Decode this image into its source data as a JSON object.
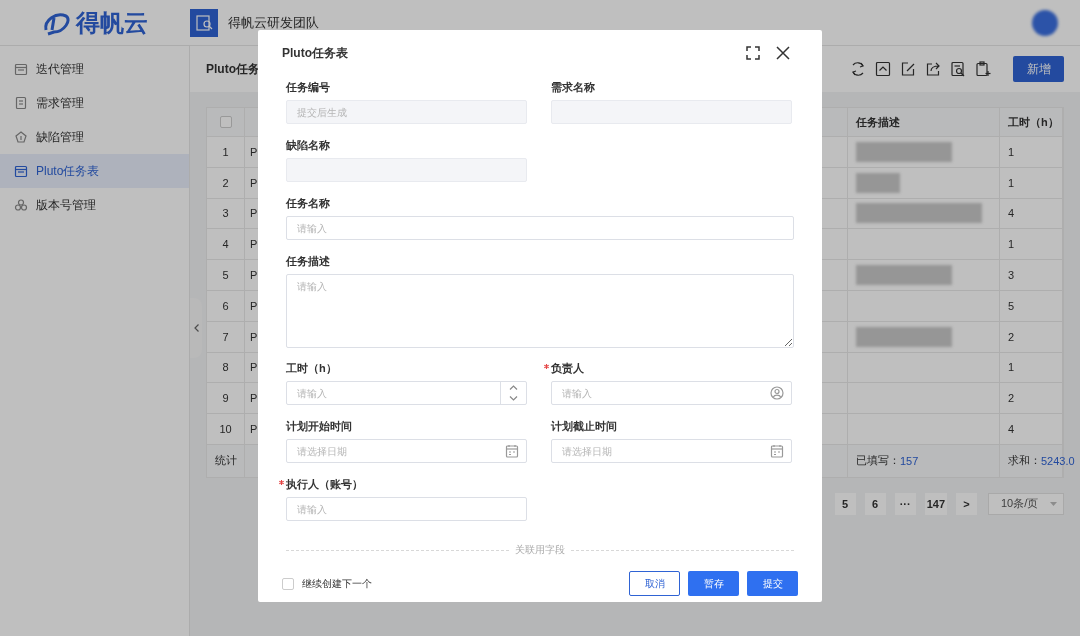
{
  "top_bar": {
    "logo_text": "得帆云",
    "team_name": "得帆云研发团队"
  },
  "sidebar": {
    "items": [
      {
        "label": "迭代管理",
        "selected": false
      },
      {
        "label": "需求管理",
        "selected": false
      },
      {
        "label": "缺陷管理",
        "selected": false
      },
      {
        "label": "Pluto任务表",
        "selected": true
      },
      {
        "label": "版本号管理",
        "selected": false
      }
    ]
  },
  "page": {
    "title": "Pluto任务",
    "new_button": "新增"
  },
  "table": {
    "select_all_checked": false,
    "columns": [
      "",
      "",
      "",
      "任务描述",
      "工时（h）"
    ],
    "rows": [
      {
        "index": "1",
        "task": "P",
        "description_blurred": true,
        "hours": "1"
      },
      {
        "index": "2",
        "task": "P",
        "description_blurred": true,
        "hours": "1"
      },
      {
        "index": "3",
        "task": "P",
        "description_blurred": true,
        "hours": "4"
      },
      {
        "index": "4",
        "task": "P",
        "description_blurred": false,
        "hours": "1"
      },
      {
        "index": "5",
        "task": "P",
        "description_blurred": true,
        "hours": "3"
      },
      {
        "index": "6",
        "task": "P",
        "description_blurred": false,
        "hours": "5"
      },
      {
        "index": "7",
        "task": "P",
        "description_blurred": true,
        "hours": "2"
      },
      {
        "index": "8",
        "task": "P",
        "description_blurred": false,
        "hours": "1"
      },
      {
        "index": "9",
        "task": "P",
        "description_blurred": false,
        "hours": "2"
      },
      {
        "index": "10",
        "task": "P",
        "description_blurred": false,
        "hours": "4"
      }
    ],
    "summary": {
      "label": "统计",
      "filled_label": "已填写：",
      "filled_value": "157",
      "sum_label": "求和：",
      "sum_value": "5243.0"
    }
  },
  "pagination": {
    "pages": [
      "5",
      "6",
      "···",
      "147"
    ],
    "next": ">",
    "page_size": "10条/页"
  },
  "modal": {
    "title": "Pluto任务表",
    "fields": [
      {
        "label": "任务编号",
        "kind": "text",
        "disabled": true,
        "required": false,
        "placeholder": "提交后生成"
      },
      {
        "label": "需求名称",
        "kind": "text",
        "disabled": true,
        "required": false
      },
      {
        "label": "缺陷名称",
        "kind": "text",
        "disabled": true,
        "required": false
      },
      {
        "label": "任务名称",
        "kind": "text",
        "disabled": false,
        "required": false,
        "placeholder": "请输入"
      },
      {
        "label": "任务描述",
        "kind": "textarea",
        "disabled": false,
        "required": false,
        "placeholder": "请输入"
      },
      {
        "label": "工时（h）",
        "kind": "number",
        "disabled": false,
        "required": false,
        "placeholder": "请输入"
      },
      {
        "label": "负责人",
        "kind": "user",
        "disabled": false,
        "required": true,
        "placeholder": "请输入"
      },
      {
        "label": "计划开始时间",
        "kind": "date",
        "disabled": false,
        "required": false,
        "placeholder": "请选择日期"
      },
      {
        "label": "计划截止时间",
        "kind": "date",
        "disabled": false,
        "required": false,
        "placeholder": "请选择日期"
      },
      {
        "label": "执行人（账号）",
        "kind": "text",
        "disabled": false,
        "required": true,
        "placeholder": "请输入"
      }
    ],
    "divider_label": "关联用字段",
    "continue_checkbox": {
      "label": "继续创建下一个",
      "checked": false
    },
    "buttons": [
      {
        "label": "取消",
        "kind": "secondary"
      },
      {
        "label": "暂存",
        "kind": "primary"
      },
      {
        "label": "提交",
        "kind": "primary"
      }
    ]
  }
}
